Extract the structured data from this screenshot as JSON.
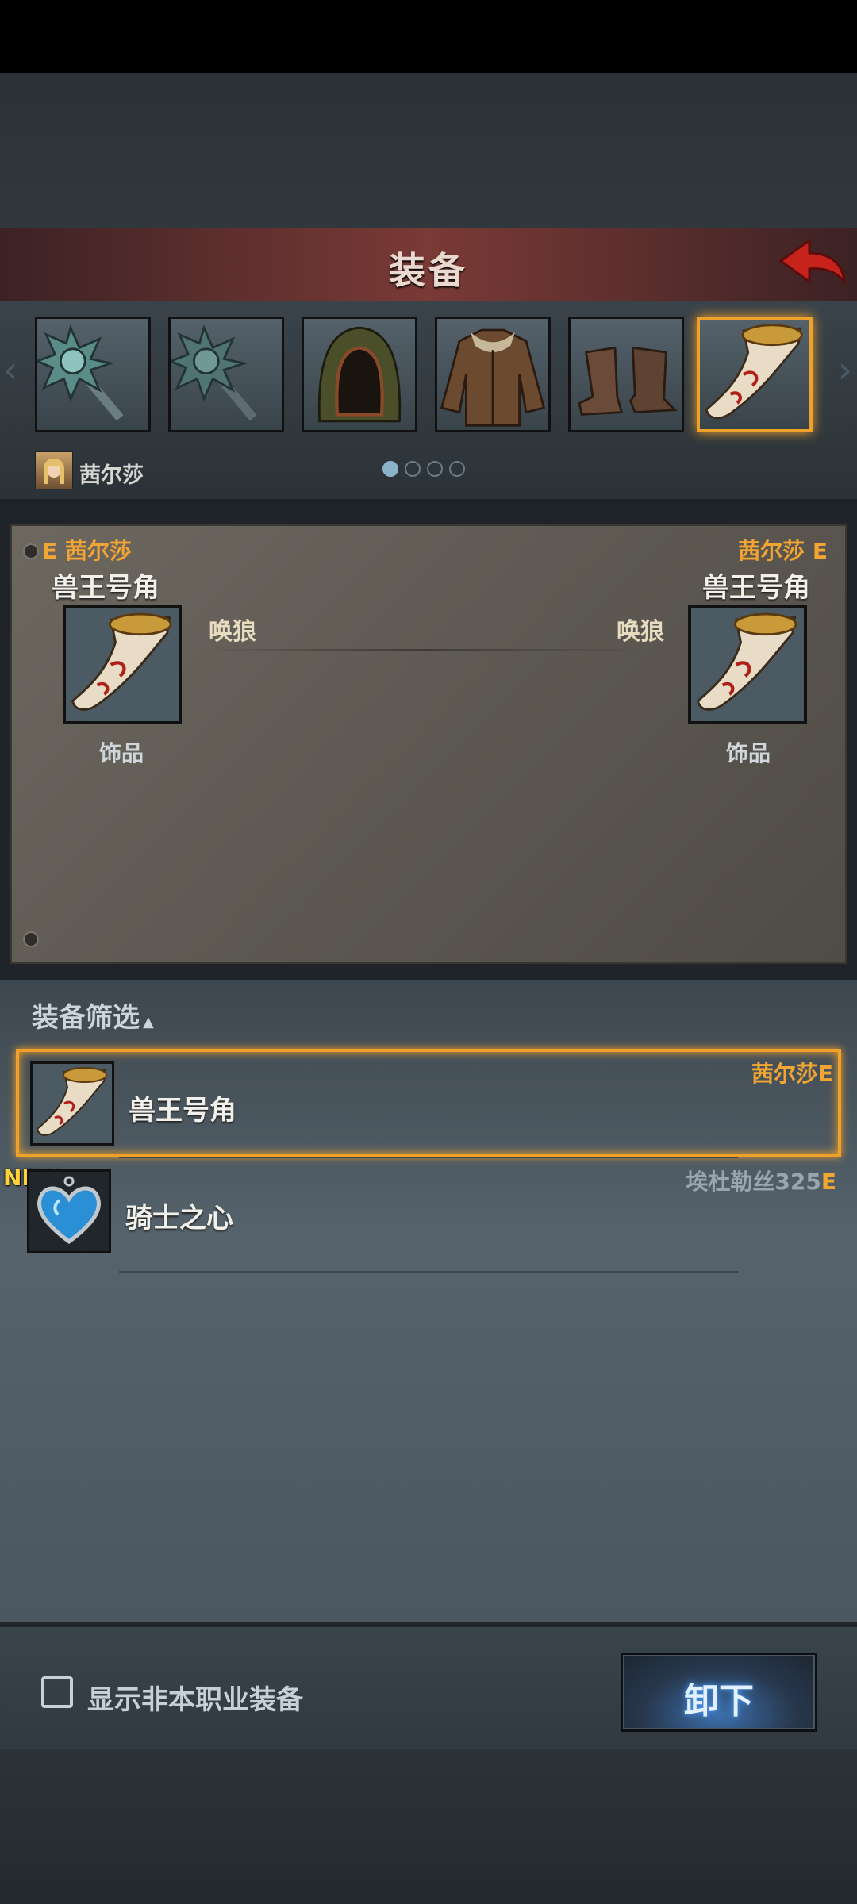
{
  "header": {
    "title": "装备"
  },
  "strip": {
    "slots": [
      {
        "icon": "spiked-mace-icon"
      },
      {
        "icon": "spiked-mace-icon"
      },
      {
        "icon": "hood-icon"
      },
      {
        "icon": "fur-coat-icon"
      },
      {
        "icon": "boots-icon"
      },
      {
        "icon": "horn-icon",
        "selected": true
      }
    ],
    "character_name": "茜尔莎",
    "page_dots": 4,
    "active_dot": 0
  },
  "compare": {
    "left": {
      "label": "E 茜尔莎",
      "item_name": "兽王号角",
      "skill": "唤狼",
      "type": "饰品"
    },
    "right": {
      "label": "茜尔莎 E",
      "item_name": "兽王号角",
      "skill": "唤狼",
      "type": "饰品"
    }
  },
  "filter": {
    "title": "装备筛选"
  },
  "list": [
    {
      "name": "兽王号角",
      "owner": "茜尔莎E",
      "icon": "horn-icon",
      "selected": true
    },
    {
      "name": "骑士之心",
      "owner_name": "埃杜勒丝325",
      "owner_suffix": "E",
      "icon": "heart-pendant-icon",
      "badge": "NEW"
    }
  ],
  "bottom": {
    "checkbox_label": "显示非本职业装备",
    "unequip_label": "卸下"
  },
  "colors": {
    "accent": "#f0a12a",
    "owner": "#f1a532",
    "header": "#7a3a36"
  }
}
